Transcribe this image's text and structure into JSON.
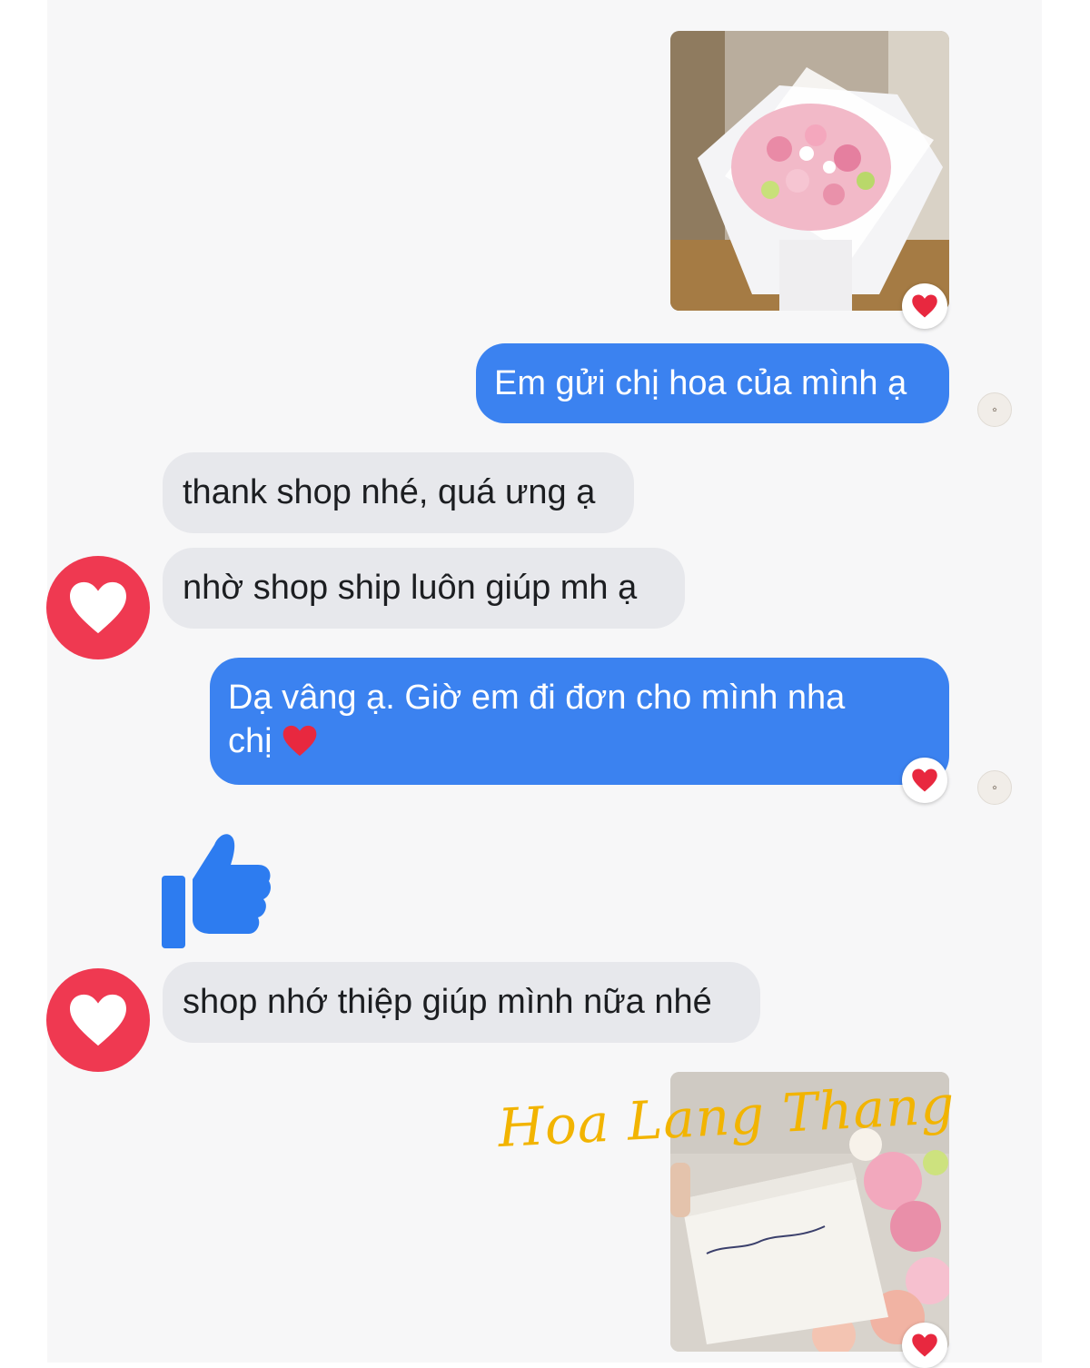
{
  "messages": {
    "m1_text": "Em gửi chị hoa của mình ạ",
    "m2_text": "thank shop nhé, quá ưng ạ",
    "m3_text": "nhờ shop ship luôn giúp mh ạ",
    "m4_line1": "Dạ vâng ạ. Giờ em đi đơn cho mình nha",
    "m4_line2": "chị",
    "m4_emoji": "❤️",
    "m5_text": "shop nhớ thiệp giúp mình nữa nhé"
  },
  "watermark": "Hoa Lang Thang",
  "colors": {
    "outgoing_bubble": "#3b82f0",
    "incoming_bubble": "#e7e8ec",
    "avatar_red": "#ef3951",
    "like_blue": "#2d7cf0",
    "watermark_yellow": "#f2b400"
  },
  "icons": {
    "reaction": "heart-icon",
    "avatar": "heart-icon",
    "sticker": "thumbs-up-icon"
  }
}
